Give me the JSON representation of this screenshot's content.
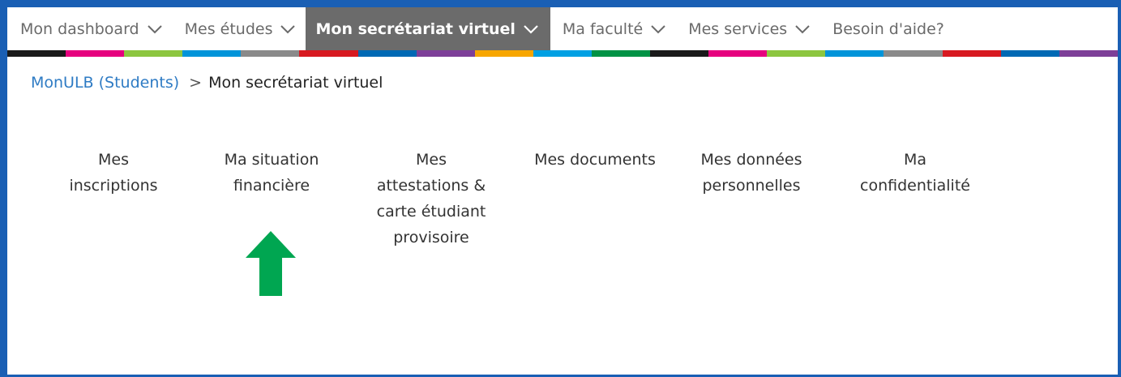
{
  "nav": {
    "items": [
      {
        "label": "Mon dashboard",
        "has_chevron": true
      },
      {
        "label": "Mes études",
        "has_chevron": true
      },
      {
        "label": "Mon secrétariat virtuel",
        "has_chevron": true,
        "active": true
      },
      {
        "label": "Ma faculté",
        "has_chevron": true
      },
      {
        "label": "Mes services",
        "has_chevron": true
      },
      {
        "label": "Besoin d'aide?",
        "has_chevron": false
      }
    ]
  },
  "colorbar": [
    "#1a1a1a",
    "#e6007e",
    "#8cc63f",
    "#0094d9",
    "#8a8a8a",
    "#d71920",
    "#0069b4",
    "#7d3f98",
    "#f7a600",
    "#00a0e3",
    "#009245",
    "#1a1a1a",
    "#e6007e",
    "#8cc63f",
    "#0094d9",
    "#8a8a8a",
    "#d71920",
    "#0069b4",
    "#7d3f98"
  ],
  "breadcrumb": {
    "root": "MonULB (Students)",
    "separator": ">",
    "current": "Mon secrétariat virtuel"
  },
  "menu": {
    "tiles": [
      {
        "label": "Mes\ninscriptions"
      },
      {
        "label": "Ma situation\nfinancière"
      },
      {
        "label": "Mes\nattestations &\ncarte étudiant\nprovisoire"
      },
      {
        "label": "Mes documents"
      },
      {
        "label": "Mes données\npersonnelles"
      },
      {
        "label": "Ma\nconfidentialité"
      }
    ]
  },
  "colors": {
    "frame": "#1a5fb4",
    "active_nav": "#6b6b6b",
    "link": "#2e7bc4",
    "arrow": "#00a651"
  },
  "annotation": {
    "icon": "up-arrow-icon"
  }
}
